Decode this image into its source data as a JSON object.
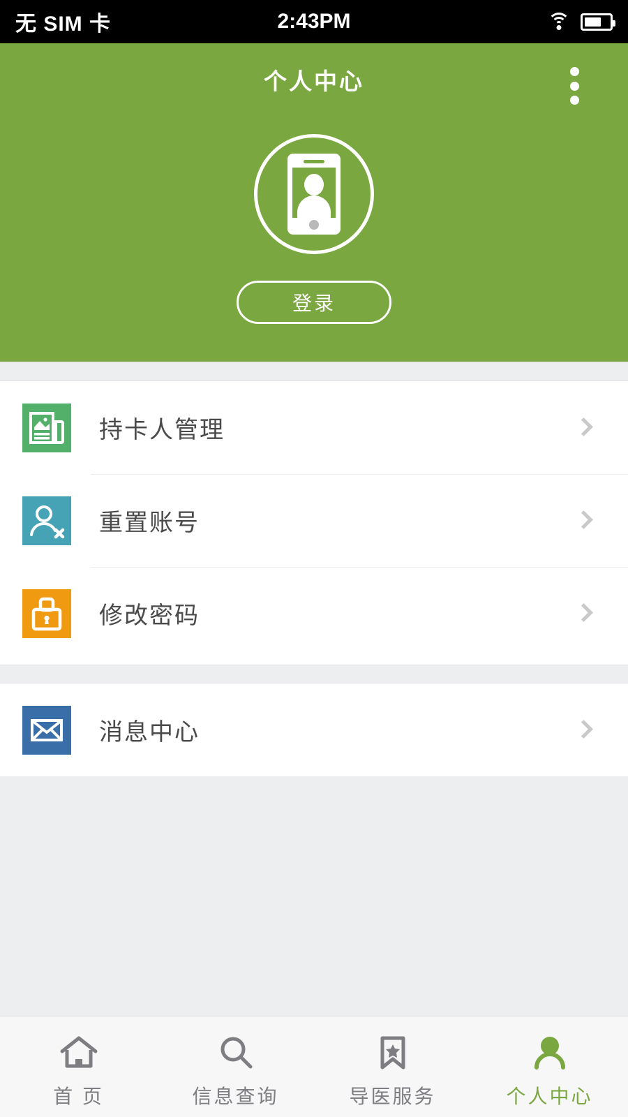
{
  "status_bar": {
    "carrier": "无 SIM 卡",
    "time": "2:43PM",
    "wifi_icon": "wifi-icon",
    "battery_icon": "battery-icon"
  },
  "header": {
    "title": "个人中心",
    "overflow_icon": "more-vertical-icon",
    "avatar_icon": "phone-user-avatar-icon",
    "login_label": "登录",
    "background_color": "#7aa73f"
  },
  "menu": {
    "groups": [
      {
        "items": [
          {
            "label": "持卡人管理",
            "icon": "card-document-icon",
            "color": "#52b06a",
            "chevron": "chevron-right-icon"
          },
          {
            "label": "重置账号",
            "icon": "user-reset-icon",
            "color": "#45a3b5",
            "chevron": "chevron-right-icon"
          },
          {
            "label": "修改密码",
            "icon": "lock-icon",
            "color": "#f09a12",
            "chevron": "chevron-right-icon"
          }
        ]
      },
      {
        "items": [
          {
            "label": "消息中心",
            "icon": "envelope-icon",
            "color": "#3a6ea8",
            "chevron": "chevron-right-icon"
          }
        ]
      }
    ]
  },
  "tabbar": {
    "active_color": "#7aa73f",
    "inactive_color": "#7d7d82",
    "tabs": [
      {
        "label": "首 页",
        "icon": "home-icon",
        "active": false
      },
      {
        "label": "信息查询",
        "icon": "search-icon",
        "active": false
      },
      {
        "label": "导医服务",
        "icon": "bookmark-star-icon",
        "active": false
      },
      {
        "label": "个人中心",
        "icon": "user-icon",
        "active": true
      }
    ]
  }
}
